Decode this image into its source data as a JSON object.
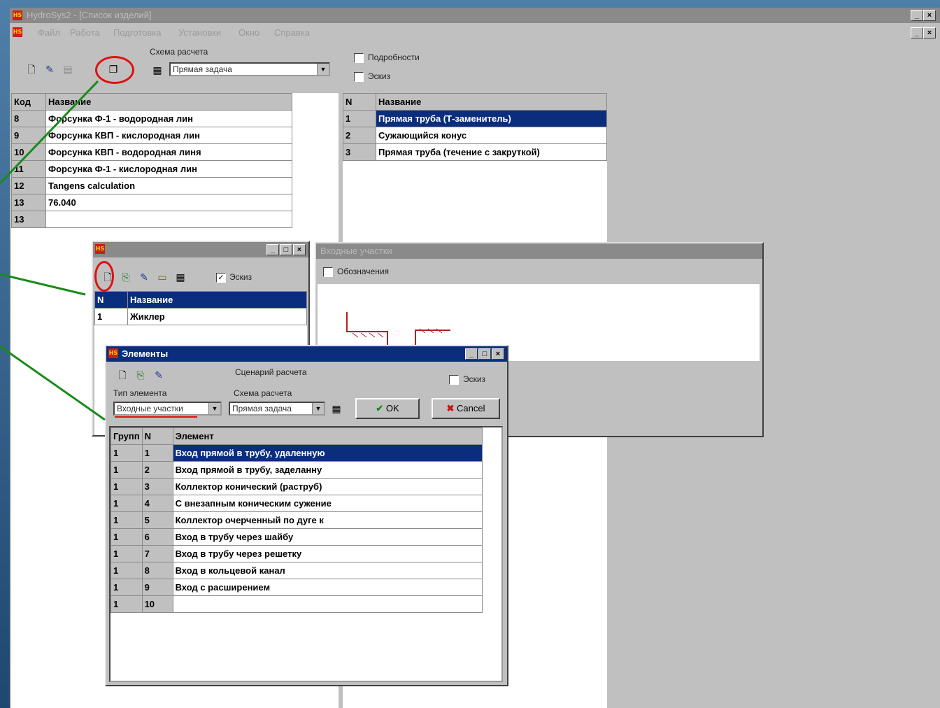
{
  "app": {
    "title": "HydroSys2 - [Список изделий]",
    "menu": [
      "Файл",
      "Работа",
      "Подготовка",
      "Установки",
      "Окно",
      "Справка"
    ]
  },
  "toolbar": {
    "scheme_label": "Схема расчета",
    "scheme_value": "Прямая задача",
    "details_label": "Подробности",
    "sketch_label": "Эскиз"
  },
  "products": {
    "headers": [
      "Код",
      "Название"
    ],
    "rows": [
      [
        "8",
        "Форсунка Ф-1 - водородная лин"
      ],
      [
        "9",
        "Форсунка КВП - кислородная лин"
      ],
      [
        "10",
        "Форсунка КВП - водородная линя"
      ],
      [
        "11",
        "Форсунка Ф-1 - кислородная лин"
      ],
      [
        "12",
        "Tangens calculation"
      ],
      [
        "13",
        "76.040"
      ],
      [
        "13",
        ""
      ]
    ]
  },
  "sections": {
    "headers": [
      "N",
      "Название"
    ],
    "rows": [
      [
        "1",
        "Прямая труба (Т-заменитель)"
      ],
      [
        "2",
        "Сужающийся конус"
      ],
      [
        "3",
        "Прямая труба (течение с закруткой)"
      ]
    ]
  },
  "sub": {
    "sketch_label": "Эскиз",
    "headers": [
      "N",
      "Название"
    ],
    "rows": [
      [
        "1",
        "Жиклер"
      ]
    ]
  },
  "inlet": {
    "title": "Входные участки",
    "legend_label": "Обозначения"
  },
  "elements": {
    "title": "Элементы",
    "scenario_label": "Сценарий расчета",
    "type_label": "Тип элемента",
    "type_value": "Входные участки",
    "scheme_label": "Схема расчета",
    "scheme_value": "Прямая задача",
    "sketch_label": "Эскиз",
    "ok_label": "OK",
    "cancel_label": "Cancel",
    "headers": [
      "Групп",
      "N",
      "Элемент"
    ],
    "rows": [
      [
        "1",
        "1",
        "Вход прямой в трубу, удаленную"
      ],
      [
        "1",
        "2",
        "Вход прямой в трубу, заделанну"
      ],
      [
        "1",
        "3",
        "Коллектор конический (раструб)"
      ],
      [
        "1",
        "4",
        "С внезапным коническим сужение"
      ],
      [
        "1",
        "5",
        "Коллектор очерченный по дуге к"
      ],
      [
        "1",
        "6",
        "Вход в трубу через шайбу"
      ],
      [
        "1",
        "7",
        "Вход в трубу через решетку"
      ],
      [
        "1",
        "8",
        "Вход в кольцевой канал"
      ],
      [
        "1",
        "9",
        "Вход с расширением"
      ],
      [
        "1",
        "10",
        ""
      ]
    ]
  },
  "colors": {
    "selection": "#0a2d7d",
    "annotation_line": "#1a8a1a",
    "annotation_ring": "#e01010"
  }
}
